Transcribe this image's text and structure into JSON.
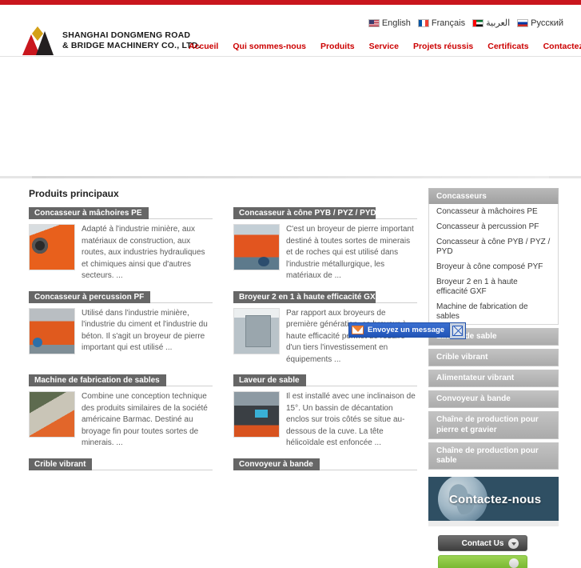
{
  "topbar": {
    "color": "#c9161d"
  },
  "header": {
    "brand_line1": "SHANGHAI DONGMENG ROAD",
    "brand_line2": "& BRIDGE MACHINERY CO., LTD.",
    "languages": [
      {
        "label": "English",
        "flag": "us-flag-icon"
      },
      {
        "label": "Français",
        "flag": "fr-flag-icon"
      },
      {
        "label": "العربية",
        "flag": "ae-flag-icon"
      },
      {
        "label": "Русский",
        "flag": "ru-flag-icon"
      }
    ],
    "nav": [
      {
        "label": "Accueil"
      },
      {
        "label": "Qui sommes-nous"
      },
      {
        "label": "Produits"
      },
      {
        "label": "Service"
      },
      {
        "label": "Projets réussis"
      },
      {
        "label": "Certificats"
      },
      {
        "label": "Contactez-nous"
      }
    ]
  },
  "main": {
    "section_title": "Produits principaux",
    "products": [
      {
        "title": "Concasseur à mâchoires PE",
        "text": "Adapté à l'industrie minière, aux matériaux de construction, aux routes, aux industries hydrauliques et chimiques ainsi que d'autres secteurs. ..."
      },
      {
        "title": "Concasseur à cône PYB / PYZ / PYD",
        "text": "C'est un broyeur de pierre important destiné à toutes sortes de minerais et de roches qui est utilisé dans l'industrie métallurgique, les matériaux de ..."
      },
      {
        "title": "Concasseur à percussion PF",
        "text": "Utilisé dans l'industrie minière, l'industrie du ciment et l'industrie du béton. Il s'agit un broyeur de pierre important qui est utilisé ..."
      },
      {
        "title": "Broyeur 2 en 1 à haute efficacité GXF",
        "text": "Par rapport aux broyeurs de première génération, ce broyeur à haute efficacité permet de réduire d'un tiers l'investissement en équipements ..."
      },
      {
        "title": "Machine de fabrication de sables",
        "text": "Combine une conception technique des produits similaires de la société américaine Barmac. Destiné au broyage fin pour toutes sortes de minerais. ..."
      },
      {
        "title": "Laveur de sable",
        "text": "Il est installé avec une inclinaison de 15°. Un bassin de décantation enclos sur trois côtés se situe au-dessous de la cuve. La tête hélicoïdale est enfoncée ..."
      },
      {
        "title": "Crible vibrant",
        "text": ""
      },
      {
        "title": "Convoyeur à bande",
        "text": ""
      }
    ]
  },
  "sidebar": {
    "category_title": "Concasseurs",
    "category_items": [
      {
        "label": "Concasseur à mâchoires PE"
      },
      {
        "label": "Concasseur à percussion PF"
      },
      {
        "label": "Concasseur à cône PYB / PYZ / PYD"
      },
      {
        "label": "Broyeur à cône composé PYF"
      },
      {
        "label": "Broyeur 2 en 1 à haute efficacité GXF"
      },
      {
        "label": "Machine de fabrication de sables"
      }
    ],
    "bars": [
      {
        "label": "Laveur de sable"
      },
      {
        "label": "Crible vibrant"
      },
      {
        "label": "Alimentateur vibrant"
      },
      {
        "label": "Convoyeur à bande"
      },
      {
        "label": "Chaîne de production pour pierre et gravier"
      },
      {
        "label": "Chaîne de production pour sable"
      }
    ],
    "contact_banner": "Contactez-nous",
    "contact_button": "Contact Us"
  },
  "widget": {
    "label": "Envoyez un message"
  }
}
